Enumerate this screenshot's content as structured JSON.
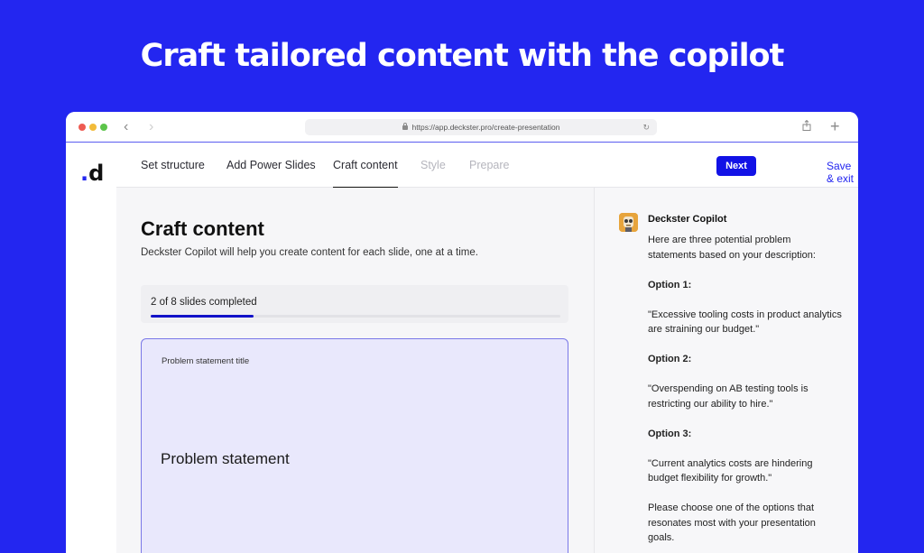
{
  "headline": "Craft tailored content with the copilot",
  "browser": {
    "url": "https://app.deckster.pro/create-presentation",
    "back": "‹",
    "forward": "›",
    "reload": "↻",
    "new_tab": "+"
  },
  "logo": {
    "letter": "d",
    "dot": "."
  },
  "nav": {
    "tabs": [
      {
        "label": "Set structure",
        "state": "normal"
      },
      {
        "label": "Add Power Slides",
        "state": "normal"
      },
      {
        "label": "Craft content",
        "state": "active"
      },
      {
        "label": "Style",
        "state": "disabled"
      },
      {
        "label": "Prepare",
        "state": "disabled"
      }
    ],
    "next_label": "Next",
    "save_exit_label": "Save & exit"
  },
  "main": {
    "title": "Craft content",
    "subtitle": "Deckster Copilot will help you create content for each slide, one at a time.",
    "progress": {
      "text": "2 of 8 slides completed",
      "completed": 2,
      "total": 8
    },
    "slide": {
      "label": "Problem statement title",
      "statement": "Problem statement"
    }
  },
  "copilot": {
    "name": "Deckster Copilot",
    "intro": "Here are three potential problem statements based on your description:",
    "options": [
      {
        "label": "Option 1:",
        "text": "\"Excessive tooling costs in product analytics are straining our budget.\""
      },
      {
        "label": "Option 2:",
        "text": "\"Overspending on AB testing tools is restricting our ability to hire.\""
      },
      {
        "label": "Option 3:",
        "text": "\"Current analytics costs are hindering budget flexibility for growth.\""
      }
    ],
    "closing": "Please choose one of the options that resonates most with your presentation goals."
  },
  "colors": {
    "background": "#2326f0",
    "accent": "#1212e6",
    "slide_card": "#e9e8fc"
  }
}
